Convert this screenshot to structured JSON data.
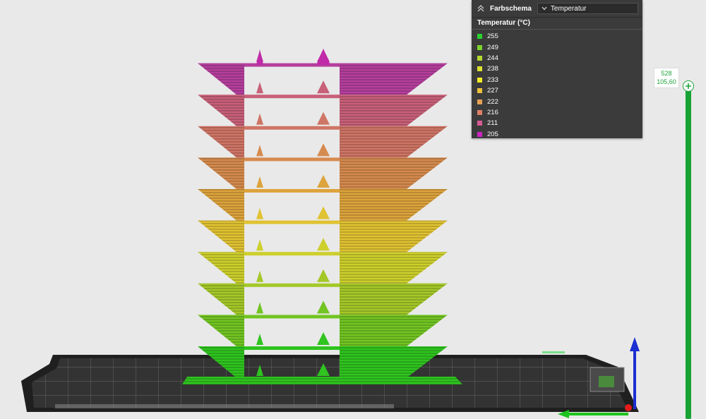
{
  "color_panel": {
    "title": "Farbschema",
    "selected_scheme": "Temperatur",
    "legend_title": "Temperatur (°C)",
    "items": [
      {
        "label": "255",
        "color": "#2bd22b"
      },
      {
        "label": "249",
        "color": "#7bd62b"
      },
      {
        "label": "244",
        "color": "#b5db2e"
      },
      {
        "label": "238",
        "color": "#dde22f"
      },
      {
        "label": "233",
        "color": "#f2ea26"
      },
      {
        "label": "227",
        "color": "#eac23a"
      },
      {
        "label": "222",
        "color": "#e6a057"
      },
      {
        "label": "216",
        "color": "#df7e67"
      },
      {
        "label": "211",
        "color": "#d85a92"
      },
      {
        "label": "205",
        "color": "#cc24c2"
      }
    ]
  },
  "layer_slider": {
    "layer": "528",
    "height": "105,60",
    "color": "#18a334"
  },
  "model": {
    "tier_colors": [
      "#2fc41f",
      "#72c522",
      "#a4c828",
      "#cdcf2c",
      "#e0c232",
      "#dda33c",
      "#d68b4e",
      "#cf7565",
      "#c86079",
      "#b53f9d"
    ],
    "tip_color": "#c02aa8"
  },
  "axes": {
    "x_color": "#1ec41e",
    "y_color": "#e31b1b",
    "z_color": "#1c2fd1"
  }
}
